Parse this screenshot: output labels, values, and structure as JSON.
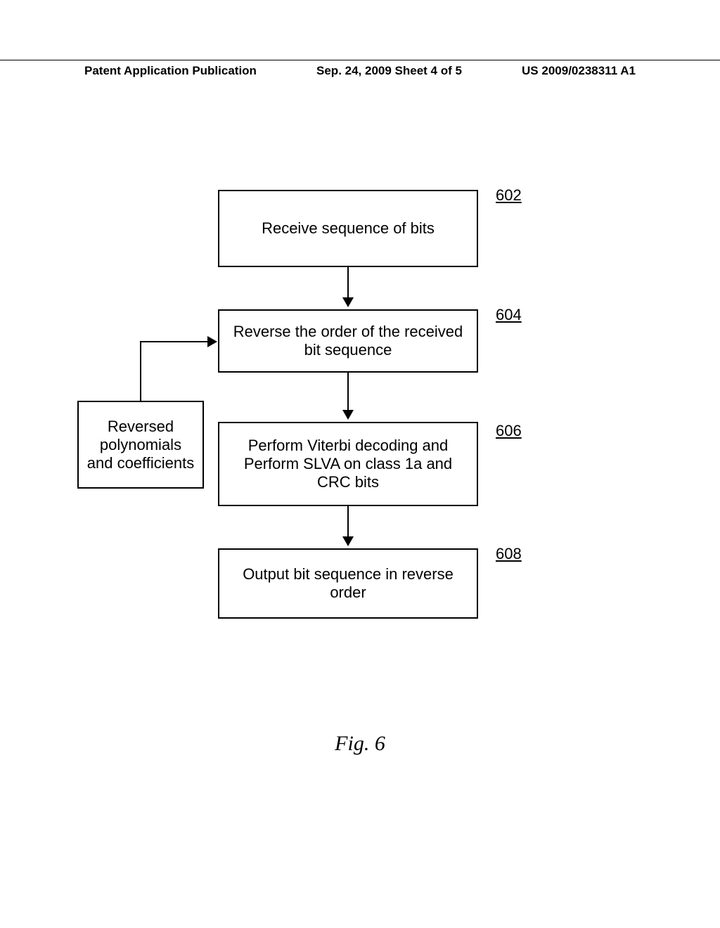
{
  "header": {
    "left": "Patent Application Publication",
    "center": "Sep. 24, 2009  Sheet 4 of 5",
    "right": "US 2009/0238311 A1"
  },
  "diagram": {
    "box602": {
      "text": "Receive sequence of bits",
      "ref": "602"
    },
    "box604": {
      "text": "Reverse the order of the received bit sequence",
      "ref": "604"
    },
    "box606": {
      "text": "Perform Viterbi decoding and Perform SLVA on class 1a and CRC bits",
      "ref": "606"
    },
    "box608": {
      "text": "Output bit sequence in reverse order",
      "ref": "608"
    },
    "sidebox": {
      "text": "Reversed polynomials and coefficients"
    }
  },
  "caption": "Fig. 6"
}
